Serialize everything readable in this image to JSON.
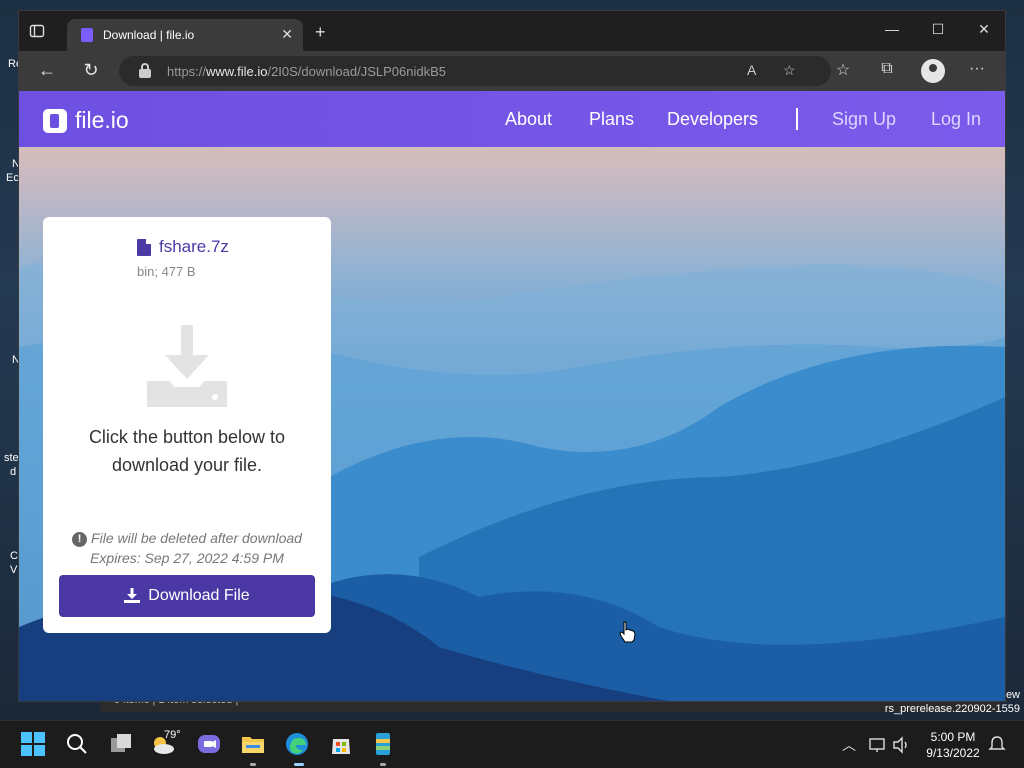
{
  "desktop": {
    "left_fragments": [
      "Re",
      "N",
      "Ec",
      "N",
      "ste",
      "d",
      "C",
      "V"
    ],
    "explorer_status": "5 items  |  1 item selected  |",
    "build_line1": "ew",
    "build_line2": "rs_prerelease.220902-1559"
  },
  "browser": {
    "tab": {
      "title": "Download | file.io",
      "close_label": "✕"
    },
    "new_tab_label": "+",
    "window_controls": {
      "minimize": "—",
      "maximize": "☐",
      "close": "✕"
    },
    "nav": {
      "back": "←",
      "reload": "↻"
    },
    "address": {
      "prefix": "https://",
      "host": "www.file.io",
      "path": "/2I0S/download/JSLP06nidkB5"
    },
    "toolbar": {
      "read_aloud": "A",
      "add_favorite": "☆",
      "favorites": "☆",
      "collections": "⧉",
      "more": "···"
    }
  },
  "site": {
    "logo_text": "file.io",
    "nav": {
      "about": "About",
      "plans": "Plans",
      "developers": "Developers",
      "signup": "Sign Up",
      "login": "Log In"
    },
    "card": {
      "file_name": "fshare.7z",
      "file_meta": "bin; 477 B",
      "message_line1": "Click the button below to",
      "message_line2": "download your file.",
      "warning_line1": "File will be deleted after download",
      "warning_line2": "Expires: Sep 27, 2022 4:59 PM",
      "warning_icon": "!",
      "download_label": "Download File"
    },
    "colors": {
      "nav_bg": "#6d4fe2",
      "button_bg": "#4b38a5",
      "file_name": "#4a3aa6"
    }
  },
  "taskbar": {
    "weather_temp": "79°",
    "clock_time": "5:00 PM",
    "clock_date": "9/13/2022",
    "icons": [
      "windows-start-icon",
      "search-icon",
      "task-view-icon",
      "weather-icon",
      "teams-chat-icon",
      "file-explorer-icon",
      "edge-icon",
      "store-icon",
      "archive-app-icon"
    ]
  }
}
